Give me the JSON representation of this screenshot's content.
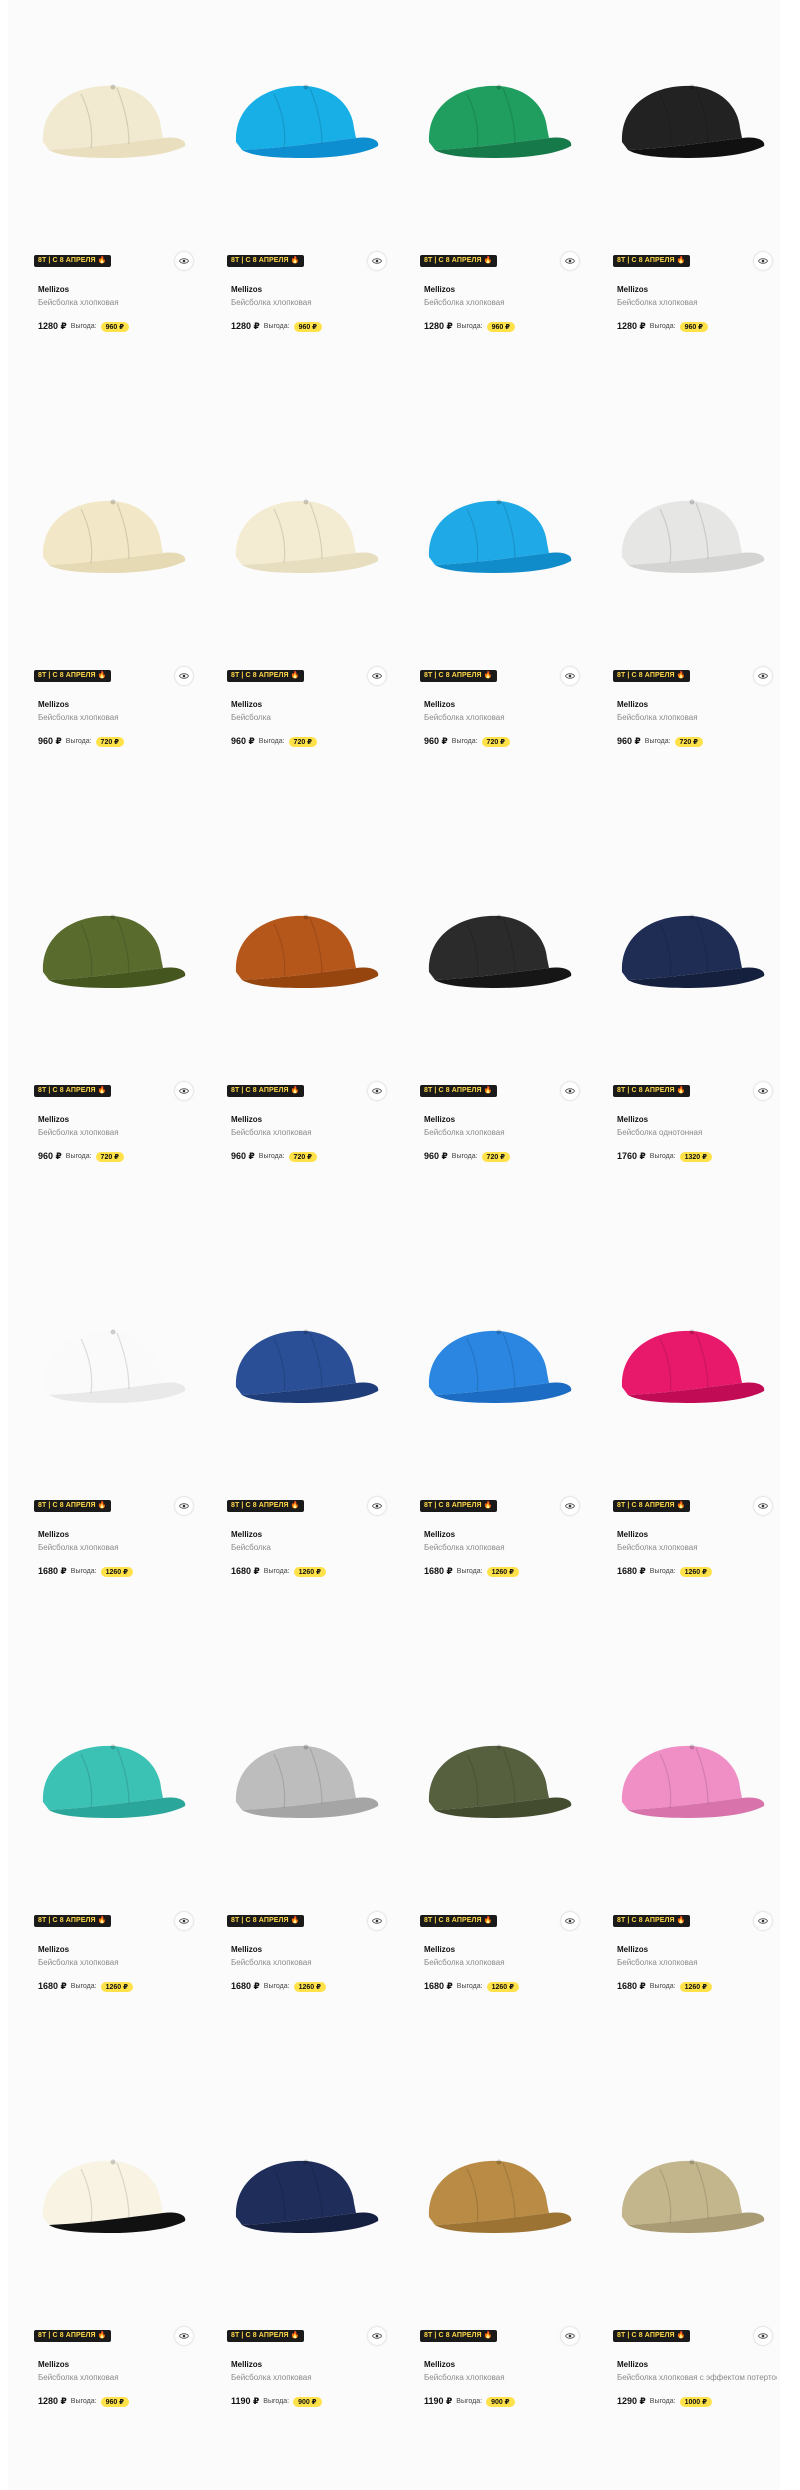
{
  "badge_text": "8Т | С 8 АПРЕЛЯ 🔥",
  "benefit_label": "Выгода:",
  "currency": "₽",
  "products": [
    {
      "brand": "Mellizos",
      "title": "Бейсболка хлопковая",
      "price": "1280 ₽",
      "benefit": "960 ₽",
      "cap_color": "#f2ead0",
      "brim_color": "#e9dfbf"
    },
    {
      "brand": "Mellizos",
      "title": "Бейсболка хлопковая",
      "price": "1280 ₽",
      "benefit": "960 ₽",
      "cap_color": "#18aee6",
      "brim_color": "#0d8ed0"
    },
    {
      "brand": "Mellizos",
      "title": "Бейсболка хлопковая",
      "price": "1280 ₽",
      "benefit": "960 ₽",
      "cap_color": "#1f9e5f",
      "brim_color": "#16794a"
    },
    {
      "brand": "Mellizos",
      "title": "Бейсболка хлопковая",
      "price": "1280 ₽",
      "benefit": "960 ₽",
      "cap_color": "#222222",
      "brim_color": "#111111"
    },
    {
      "brand": "Mellizos",
      "title": "Бейсболка хлопковая",
      "price": "960 ₽",
      "benefit": "720 ₽",
      "cap_color": "#f2e8c8",
      "brim_color": "#e6dab4"
    },
    {
      "brand": "Mellizos",
      "title": "Бейсболка",
      "price": "960 ₽",
      "benefit": "720 ₽",
      "cap_color": "#f4ecd2",
      "brim_color": "#e7ddbf"
    },
    {
      "brand": "Mellizos",
      "title": "Бейсболка хлопковая",
      "price": "960 ₽",
      "benefit": "720 ₽",
      "cap_color": "#1fa9e6",
      "brim_color": "#118ccb"
    },
    {
      "brand": "Mellizos",
      "title": "Бейсболка хлопковая",
      "price": "960 ₽",
      "benefit": "720 ₽",
      "cap_color": "#e6e6e4",
      "brim_color": "#d4d4d2"
    },
    {
      "brand": "Mellizos",
      "title": "Бейсболка хлопковая",
      "price": "960 ₽",
      "benefit": "720 ₽",
      "cap_color": "#5a6b2e",
      "brim_color": "#46561f"
    },
    {
      "brand": "Mellizos",
      "title": "Бейсболка хлопковая",
      "price": "960 ₽",
      "benefit": "720 ₽",
      "cap_color": "#b5561b",
      "brim_color": "#97450f"
    },
    {
      "brand": "Mellizos",
      "title": "Бейсболка хлопковая",
      "price": "960 ₽",
      "benefit": "720 ₽",
      "cap_color": "#2b2b2b",
      "brim_color": "#161616"
    },
    {
      "brand": "Mellizos",
      "title": "Бейсболка однотонная",
      "price": "1760 ₽",
      "benefit": "1320 ₽",
      "cap_color": "#1f2d55",
      "brim_color": "#151f3e"
    },
    {
      "brand": "Mellizos",
      "title": "Бейсболка хлопковая",
      "price": "1680 ₽",
      "benefit": "1260 ₽",
      "cap_color": "#fafafa",
      "brim_color": "#e9e9e9"
    },
    {
      "brand": "Mellizos",
      "title": "Бейсболка",
      "price": "1680 ₽",
      "benefit": "1260 ₽",
      "cap_color": "#2a4f96",
      "brim_color": "#1f3d78"
    },
    {
      "brand": "Mellizos",
      "title": "Бейсболка хлопковая",
      "price": "1680 ₽",
      "benefit": "1260 ₽",
      "cap_color": "#2a86e0",
      "brim_color": "#1b6cc2"
    },
    {
      "brand": "Mellizos",
      "title": "Бейсболка хлопковая",
      "price": "1680 ₽",
      "benefit": "1260 ₽",
      "cap_color": "#e8196a",
      "brim_color": "#c10c55"
    },
    {
      "brand": "Mellizos",
      "title": "Бейсболка хлопковая",
      "price": "1680 ₽",
      "benefit": "1260 ₽",
      "cap_color": "#3cc1b5",
      "brim_color": "#2aa69a"
    },
    {
      "brand": "Mellizos",
      "title": "Бейсболка хлопковая",
      "price": "1680 ₽",
      "benefit": "1260 ₽",
      "cap_color": "#bdbdbd",
      "brim_color": "#a5a5a5"
    },
    {
      "brand": "Mellizos",
      "title": "Бейсболка хлопковая",
      "price": "1680 ₽",
      "benefit": "1260 ₽",
      "cap_color": "#56603f",
      "brim_color": "#434c2f"
    },
    {
      "brand": "Mellizos",
      "title": "Бейсболка хлопковая",
      "price": "1680 ₽",
      "benefit": "1260 ₽",
      "cap_color": "#ef8fc5",
      "brim_color": "#d873ac"
    },
    {
      "brand": "Mellizos",
      "title": "Бейсболка хлопковая",
      "price": "1280 ₽",
      "benefit": "960 ₽",
      "cap_color": "#f8f3e3",
      "brim_color": "#111111"
    },
    {
      "brand": "Mellizos",
      "title": "Бейсболка хлопковая",
      "price": "1190 ₽",
      "benefit": "900 ₽",
      "cap_color": "#1f2d5a",
      "brim_color": "#151f40"
    },
    {
      "brand": "Mellizos",
      "title": "Бейсболка хлопковая",
      "price": "1190 ₽",
      "benefit": "900 ₽",
      "cap_color": "#b98b45",
      "brim_color": "#9d7333"
    },
    {
      "brand": "Mellizos",
      "title": "Бейсболка хлопковая с эффектом потертости",
      "price": "1290 ₽",
      "benefit": "1000 ₽",
      "cap_color": "#c3b58c",
      "brim_color": "#a99b73"
    }
  ]
}
